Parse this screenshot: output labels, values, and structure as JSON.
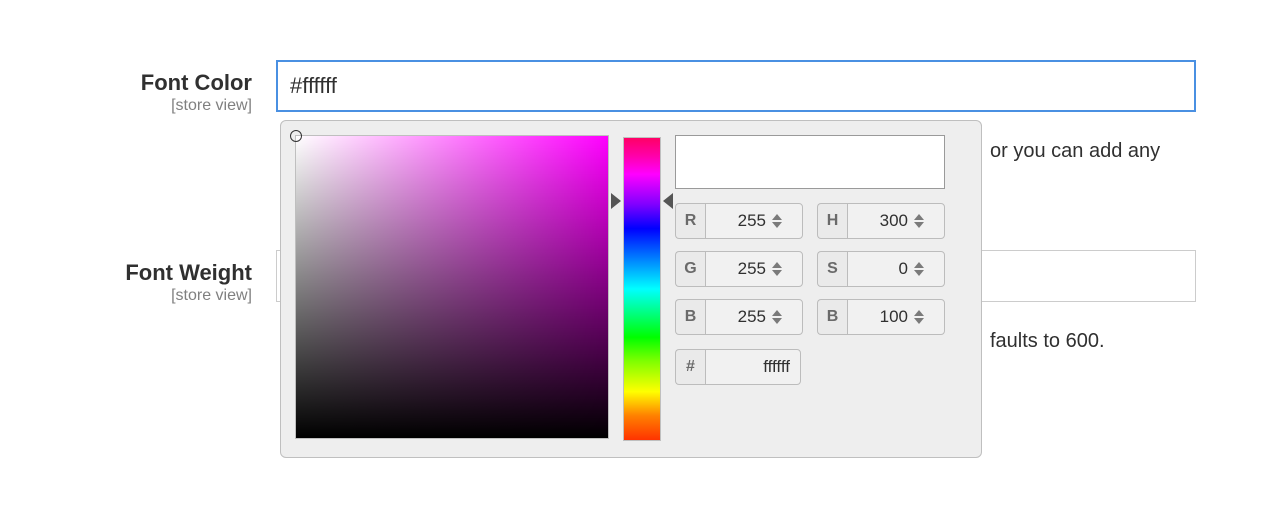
{
  "fields": {
    "fontColor": {
      "label": "Font Color",
      "scope": "[store view]",
      "value": "#ffffff",
      "hint_visible": "or you can add any"
    },
    "fontWeight": {
      "label": "Font Weight",
      "scope": "[store view]",
      "value": "",
      "hint_visible": "faults to 600."
    }
  },
  "colorpicker": {
    "swatch_hex": "#ffffff",
    "rgb": {
      "r_label": "R",
      "r": "255",
      "g_label": "G",
      "g": "255",
      "b_label": "B",
      "b": "255"
    },
    "hsb": {
      "h_label": "H",
      "h": "300",
      "s_label": "S",
      "s": "0",
      "b_label": "B",
      "b": "100"
    },
    "hex_label": "#",
    "hex": "ffffff"
  }
}
